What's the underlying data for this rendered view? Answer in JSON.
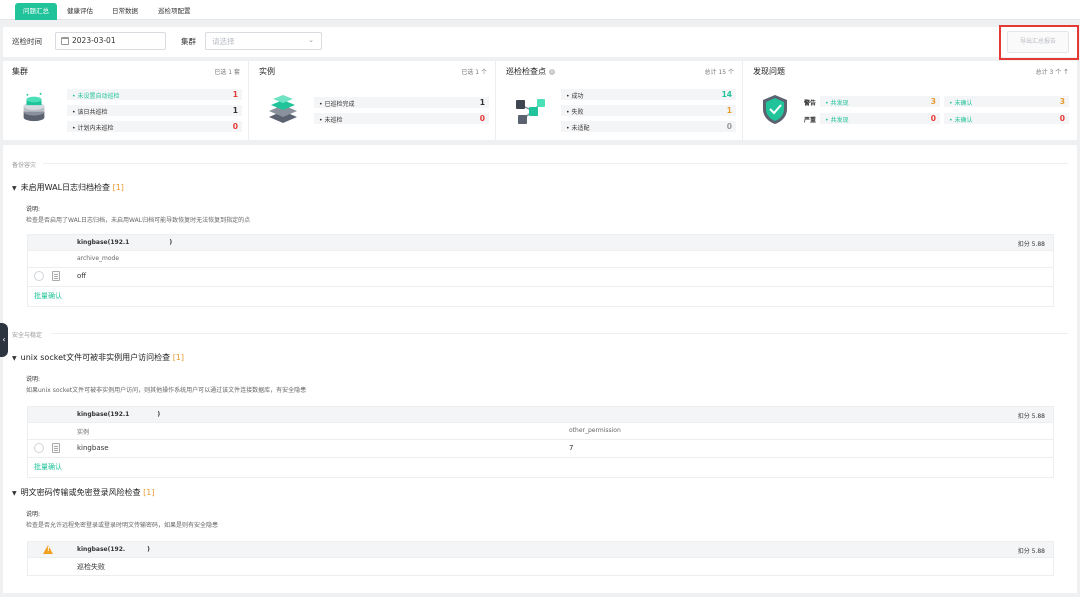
{
  "tabs": [
    {
      "label": "问题汇总"
    },
    {
      "label": "健康评估"
    },
    {
      "label": "日常数据"
    },
    {
      "label": "巡检项配置"
    }
  ],
  "filter": {
    "time_label": "巡检时间",
    "date_value": "2023-03-01",
    "cluster_label": "集群",
    "cluster_placeholder": "请选择",
    "export_label": "导出汇总报告"
  },
  "summary": {
    "cluster": {
      "title": "集群",
      "meta": "已选 1 套",
      "icon": "database-stack-icon",
      "rows": [
        {
          "label": "• 未设置自动巡检",
          "value": "1",
          "color": "#21c39a"
        },
        {
          "label": "• 该日共巡检",
          "value": "1",
          "color": "#333333"
        },
        {
          "label": "• 计划内未巡检",
          "value": "0",
          "color": "#e53935"
        }
      ]
    },
    "instance": {
      "title": "实例",
      "meta": "已选 1 个",
      "icon": "layered-cubes-icon",
      "rows": [
        {
          "label": "• 已巡检完成",
          "value": "1",
          "color": "#333333"
        },
        {
          "label": "• 未巡检",
          "value": "0",
          "color": "#e53935"
        }
      ]
    },
    "checkpoint": {
      "title": "巡检检查点",
      "meta": "总计 15 个",
      "icon": "network-nodes-icon",
      "rows": [
        {
          "label": "• 成功",
          "value": "14",
          "color": "#21c39a"
        },
        {
          "label": "• 失败",
          "value": "1",
          "color": "#e69a2e"
        },
        {
          "label": "• 未适配",
          "value": "0",
          "color": "#999999"
        }
      ]
    },
    "issues": {
      "title": "发现问题",
      "meta": "总计 3 个",
      "icon": "shield-check-icon",
      "warn": {
        "level": "警告",
        "found_label": "• 共发现",
        "found_value": "3",
        "unconfirmed_label": "• 未确认",
        "unconfirmed_value": "3"
      },
      "severe": {
        "level": "严重",
        "found_label": "• 共发现",
        "found_value": "0",
        "unconfirmed_label": "• 未确认",
        "unconfirmed_value": "0"
      }
    }
  },
  "sections": {
    "backup": {
      "heading": "备份容灾",
      "check": {
        "title": "未启用WAL日志归档检查",
        "count": "[1]",
        "desc_label": "说明:",
        "desc": "检查是否启用了WAL日志归档，未启用WAL归档可能导致恢复时无法恢复到指定的点",
        "host": "kingbase(192.1",
        "score": "扣分 5.88",
        "column": "archive_mode",
        "value": "off",
        "batch": "批量确认"
      }
    },
    "security": {
      "heading": "安全与稳定",
      "check1": {
        "title": "unix socket文件可被非实例用户访问检查",
        "count": "[1]",
        "desc_label": "说明:",
        "desc": "如果unix socket文件可被非实例用户访问，则其他操作系统用户可以通过该文件连接数据库，有安全隐患",
        "host": "kingbase(192.1",
        "score": "扣分 5.88",
        "col1": "实例",
        "col2": "other_permission",
        "val1": "kingbase",
        "val2": "7",
        "batch": "批量确认"
      },
      "check2": {
        "title": "明文密码传输或免密登录风险检查",
        "count": "[1]",
        "desc_label": "说明:",
        "desc": "检查是否允许远程免密登录或登录时明文传输密码，如果是则有安全隐患",
        "host": "kingbase(192.",
        "score": "扣分 5.88",
        "status": "巡检失败"
      }
    }
  }
}
